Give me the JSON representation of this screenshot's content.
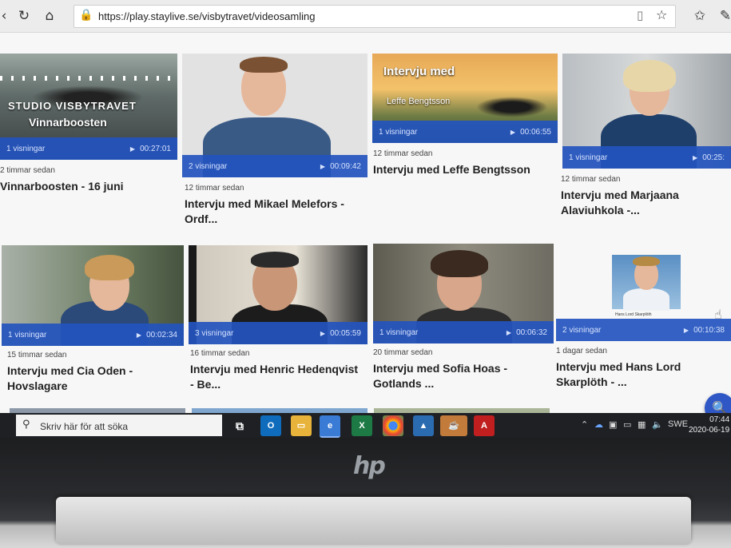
{
  "browser": {
    "url": "https://play.staylive.se/visbytravet/videosamling"
  },
  "cards": [
    {
      "views": "1 visningar",
      "duration": "00:27:01",
      "time": "2 timmar sedan",
      "title": "Vinnarboosten - 16 juni",
      "overlay1": "STUDIO VISBYTRAVET",
      "overlay2": "Vinnarboosten"
    },
    {
      "views": "2 visningar",
      "duration": "00:09:42",
      "time": "12 timmar sedan",
      "title1": "Intervju med Mikael Melefors -",
      "title2": "Ordf..."
    },
    {
      "views": "1 visningar",
      "duration": "00:06:55",
      "time": "12 timmar sedan",
      "title": "Intervju med Leffe Bengtsson",
      "overlay1": "Intervju med",
      "overlay2": "Leffe Bengtsson"
    },
    {
      "views": "1 visningar",
      "duration": "00:25:",
      "time": "12 timmar sedan",
      "title1": "Intervju med Marjaana",
      "title2": "Alaviuhkola -..."
    },
    {
      "views": "1 visningar",
      "duration": "00:02:34",
      "time": "15 timmar sedan",
      "title1": "Intervju med Cia Oden -",
      "title2": "Hovslagare"
    },
    {
      "views": "3 visningar",
      "duration": "00:05:59",
      "time": "16 timmar sedan",
      "title1": "Intervju med Henric Hedenqvist",
      "title2": "- Be..."
    },
    {
      "views": "1 visningar",
      "duration": "00:06:32",
      "time": "20 timmar sedan",
      "title1": "Intervju med Sofia Hoas -",
      "title2": "Gotlands ..."
    },
    {
      "views": "2 visningar",
      "duration": "00:10:38",
      "time": "1 dagar sedan",
      "title1": "Intervju med Hans Lord",
      "title2": "Skarplöth - ...",
      "caption": "Hans Lord Skarplöth"
    }
  ],
  "taskbar": {
    "search_placeholder": "Skriv här för att söka",
    "language": "SWE",
    "time": "07:44",
    "date": "2020-06-19",
    "apps": [
      "task-view",
      "outlook",
      "file-explorer",
      "edge",
      "excel",
      "chrome",
      "photos",
      "java",
      "acrobat"
    ]
  },
  "colors": {
    "accent": "#2f57c6",
    "bar": "#2354be"
  }
}
